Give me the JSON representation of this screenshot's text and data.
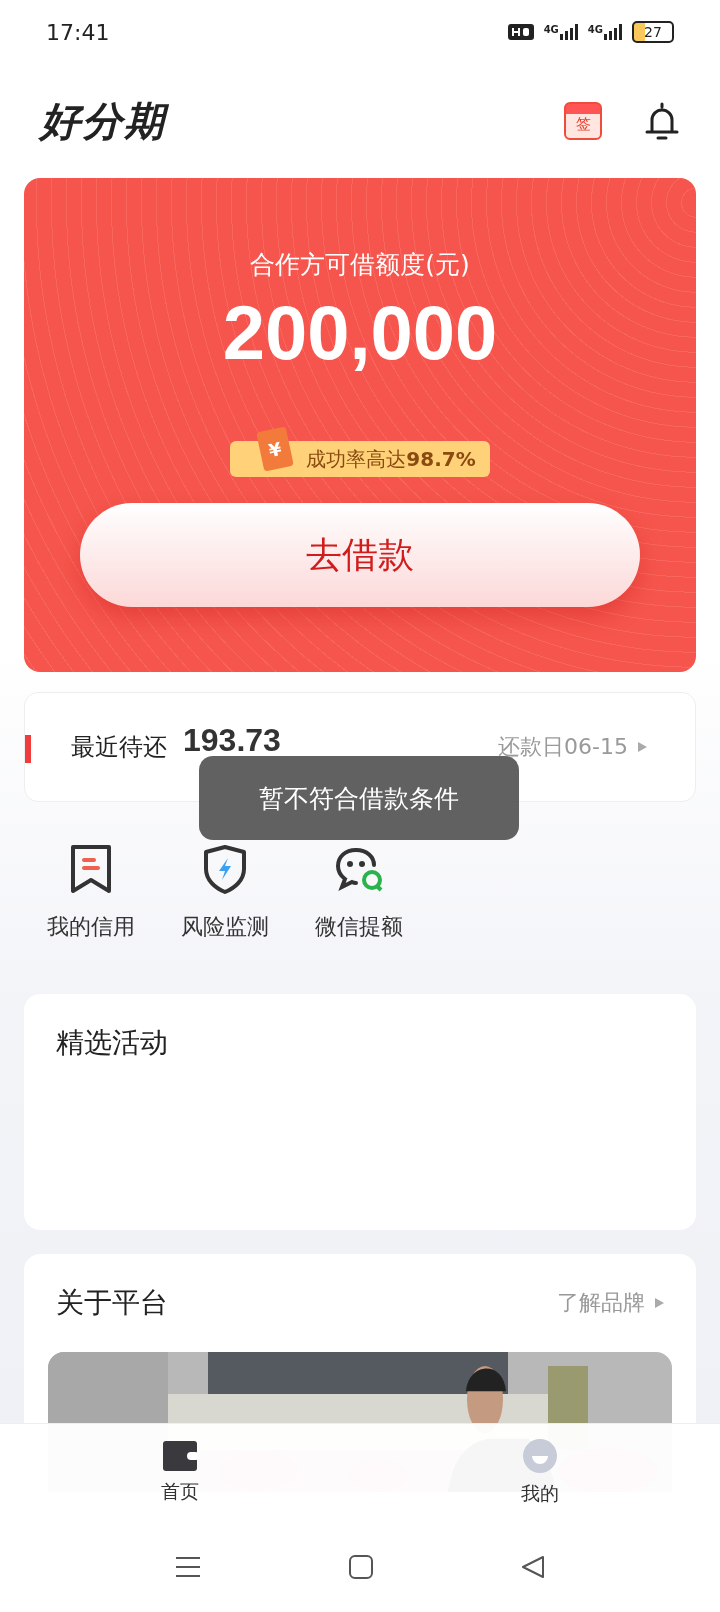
{
  "status_bar": {
    "time": "17:41",
    "network_1": "4G",
    "network_2": "4G",
    "battery": "27"
  },
  "header": {
    "logo": "好分期",
    "sign_in_label": "签"
  },
  "credit_card": {
    "title": "合作方可借额度(元)",
    "amount": "200,000",
    "badge": "成功率高达**98.7%**",
    "badge_icon": "¥",
    "button": "去借款"
  },
  "repayment": {
    "label": "最近待还",
    "amount": "193.73",
    "due": "还款日06-15"
  },
  "toast": "暂不符合借款条件",
  "shortcuts": [
    {
      "label": "我的信用",
      "kind": "bookmark"
    },
    {
      "label": "风险监测",
      "kind": "shield"
    },
    {
      "label": "微信提额",
      "kind": "chat"
    }
  ],
  "activities": {
    "title": "精选活动"
  },
  "about": {
    "title": "关于平台",
    "link": "了解品牌"
  },
  "bottom_nav": [
    {
      "label": "首页",
      "kind": "home",
      "selected": true
    },
    {
      "label": "我的",
      "kind": "profile",
      "selected": false
    }
  ]
}
